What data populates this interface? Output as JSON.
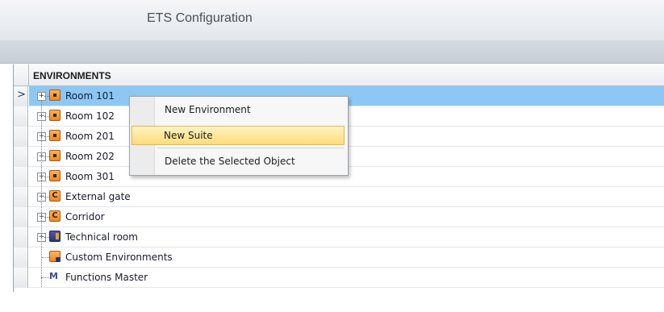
{
  "window": {
    "title": "ETS Configuration"
  },
  "grid": {
    "column_header": "ENVIRONMENTS",
    "rows": [
      {
        "label": "Room 101",
        "icon": "room-icon",
        "expandable": true,
        "selected": true
      },
      {
        "label": "Room 102",
        "icon": "room-icon",
        "expandable": true
      },
      {
        "label": "Room 201",
        "icon": "room-icon",
        "expandable": true
      },
      {
        "label": "Room 202",
        "icon": "room-icon",
        "expandable": true
      },
      {
        "label": "Room 301",
        "icon": "room-icon",
        "expandable": true
      },
      {
        "label": "External gate",
        "icon": "common-area-icon",
        "icon_glyph": "C",
        "expandable": true
      },
      {
        "label": "Corridor",
        "icon": "common-area-icon",
        "icon_glyph": "C",
        "expandable": true
      },
      {
        "label": "Technical room",
        "icon": "technical-room-icon",
        "expandable": true
      },
      {
        "label": "Custom Environments",
        "icon": "custom-environment-icon",
        "expandable": false
      },
      {
        "label": "Functions Master",
        "icon": "functions-master-icon",
        "icon_glyph": "M",
        "expandable": false
      }
    ],
    "expander_glyph": "+",
    "selected_row_glyph": ">"
  },
  "context_menu": {
    "items": [
      {
        "label": "New Environment"
      },
      {
        "label": "New Suite",
        "hovered": true
      },
      {
        "label": "Delete the Selected Object"
      }
    ]
  },
  "colors": {
    "selection": "#8cc8f3",
    "menu_hover": "#ffdc7a",
    "room_icon": "#f08a1d"
  }
}
